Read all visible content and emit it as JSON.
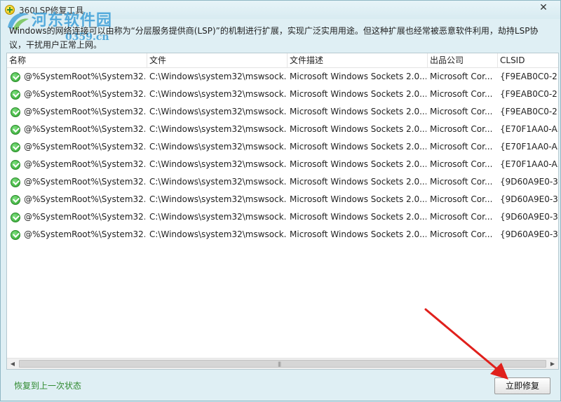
{
  "window": {
    "title": "360LSP修复工具",
    "close_glyph": "✕"
  },
  "watermark": {
    "name": "河东软件园",
    "url": "0359.cn"
  },
  "description": "Windows的网络连接可以由称为“分层服务提供商(LSP)”的机制进行扩展，实现广泛实用用途。但这种扩展也经常被恶意软件利用，劫持LSP协议，干扰用户正常上网。",
  "table": {
    "columns": [
      "名称",
      "文件",
      "文件描述",
      "出品公司",
      "CLSID"
    ],
    "rows": [
      [
        "@%SystemRoot%\\System32...",
        "C:\\Windows\\system32\\mswsock...",
        "Microsoft Windows Sockets 2.0...",
        "Microsoft Cor...",
        "{F9EAB0C0-2..."
      ],
      [
        "@%SystemRoot%\\System32...",
        "C:\\Windows\\system32\\mswsock...",
        "Microsoft Windows Sockets 2.0...",
        "Microsoft Cor...",
        "{F9EAB0C0-2..."
      ],
      [
        "@%SystemRoot%\\System32...",
        "C:\\Windows\\system32\\mswsock...",
        "Microsoft Windows Sockets 2.0...",
        "Microsoft Cor...",
        "{F9EAB0C0-2..."
      ],
      [
        "@%SystemRoot%\\System32...",
        "C:\\Windows\\system32\\mswsock...",
        "Microsoft Windows Sockets 2.0...",
        "Microsoft Cor...",
        "{E70F1AA0-A..."
      ],
      [
        "@%SystemRoot%\\System32...",
        "C:\\Windows\\system32\\mswsock...",
        "Microsoft Windows Sockets 2.0...",
        "Microsoft Cor...",
        "{E70F1AA0-A..."
      ],
      [
        "@%SystemRoot%\\System32...",
        "C:\\Windows\\system32\\mswsock...",
        "Microsoft Windows Sockets 2.0...",
        "Microsoft Cor...",
        "{E70F1AA0-A..."
      ],
      [
        "@%SystemRoot%\\System32...",
        "C:\\Windows\\system32\\mswsock...",
        "Microsoft Windows Sockets 2.0...",
        "Microsoft Cor...",
        "{9D60A9E0-3..."
      ],
      [
        "@%SystemRoot%\\System32...",
        "C:\\Windows\\system32\\mswsock...",
        "Microsoft Windows Sockets 2.0...",
        "Microsoft Cor...",
        "{9D60A9E0-3..."
      ],
      [
        "@%SystemRoot%\\System32...",
        "C:\\Windows\\system32\\mswsock...",
        "Microsoft Windows Sockets 2.0...",
        "Microsoft Cor...",
        "{9D60A9E0-3..."
      ],
      [
        "@%SystemRoot%\\System32...",
        "C:\\Windows\\system32\\mswsock...",
        "Microsoft Windows Sockets 2.0...",
        "Microsoft Cor...",
        "{9D60A9E0-3..."
      ]
    ],
    "row_status_icon": "check-circle-icon"
  },
  "scrollbar": {
    "left_glyph": "◀",
    "right_glyph": "▶",
    "grip_glyph": "|||"
  },
  "footer": {
    "restore_label": "恢复到上一次状态",
    "repair_label": "立即修复"
  },
  "colors": {
    "accent_green": "#2f8a2f",
    "window_bg": "#dfeff4",
    "annotation_red": "#e0201c",
    "watermark_blue": "#3c9fd8"
  }
}
